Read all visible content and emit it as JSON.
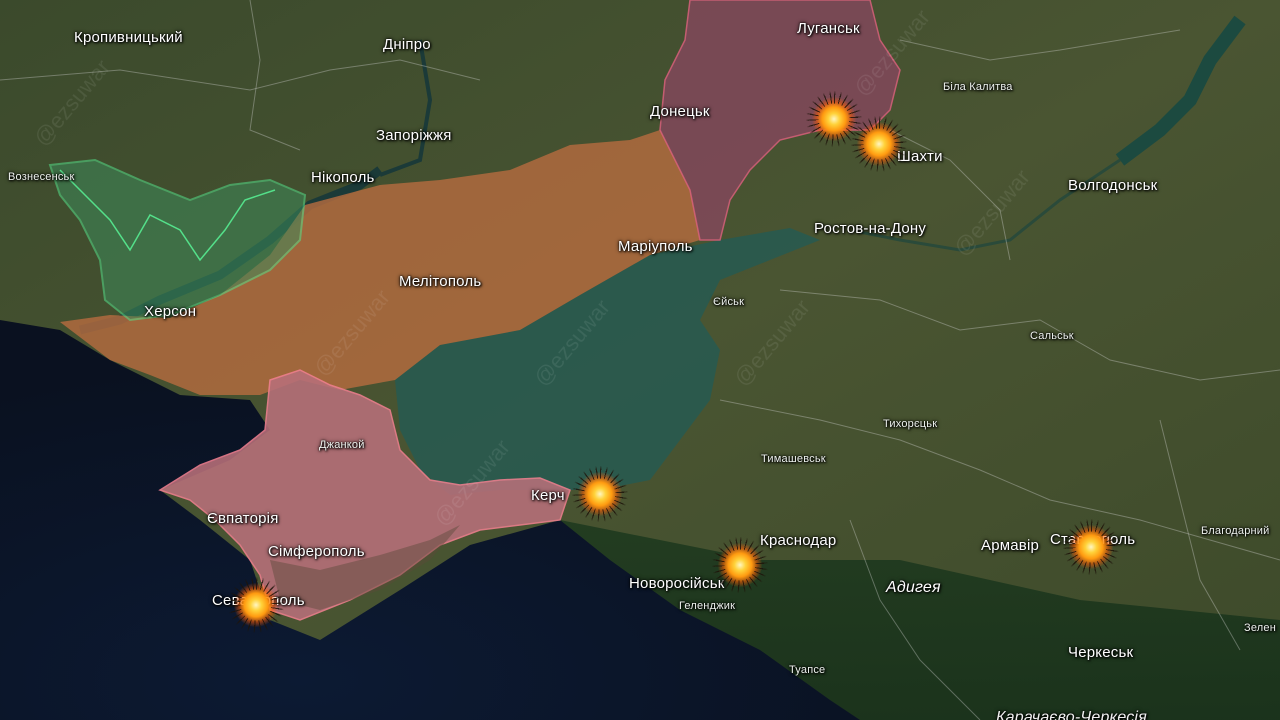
{
  "map": {
    "watermark": "@ezsuwar",
    "regions": [
      {
        "id": "occupied-south",
        "color": "#b86a40"
      },
      {
        "id": "occupied-east",
        "color": "#8a4a5a"
      },
      {
        "id": "crimea",
        "color": "#b8707a"
      },
      {
        "id": "liberated-kherson",
        "color": "#3aa66a"
      }
    ],
    "labels": {
      "kropyvnytskyi": "Кропивницький",
      "dnipro": "Дніпро",
      "zaporizhzhia": "Запоріжжя",
      "nikopol": "Нікополь",
      "voznesensk": "Вознесенськ",
      "kherson": "Херсон",
      "melitopol": "Мелітополь",
      "mariupol": "Маріуполь",
      "donetsk": "Донецьк",
      "luhansk": "Луганськ",
      "bila_kalytva": "Біла Калитва",
      "shakhty": "Шахти",
      "volgodonsk": "Волгодонськ",
      "rostov": "Ростов-на-Дону",
      "yeisk": "Єйськ",
      "salsk": "Сальськ",
      "tikhoretsk": "Тихорєцьк",
      "timashevsk": "Тимашевськ",
      "kerch": "Керч",
      "dzhankoi": "Джанкой",
      "yevpatoria": "Євпаторія",
      "simferopol": "Сімферополь",
      "sevastopol": "Севастополь",
      "krasnodar": "Краснодар",
      "novorossiysk": "Новоросійськ",
      "gelendzhik": "Геленджик",
      "tuapse": "Туапсе",
      "adygea": "Адигея",
      "armavir": "Армавір",
      "stavropol": "Ставрополь",
      "blagodarnyi": "Благодарний",
      "cherkessk": "Черкеськ",
      "zelenchuk": "Зелен",
      "karachay": "Карачаєво-Черкесія"
    },
    "strikes": [
      "luhansk-area",
      "shakhty",
      "kerch",
      "novorossiysk",
      "stavropol",
      "sevastopol"
    ]
  }
}
